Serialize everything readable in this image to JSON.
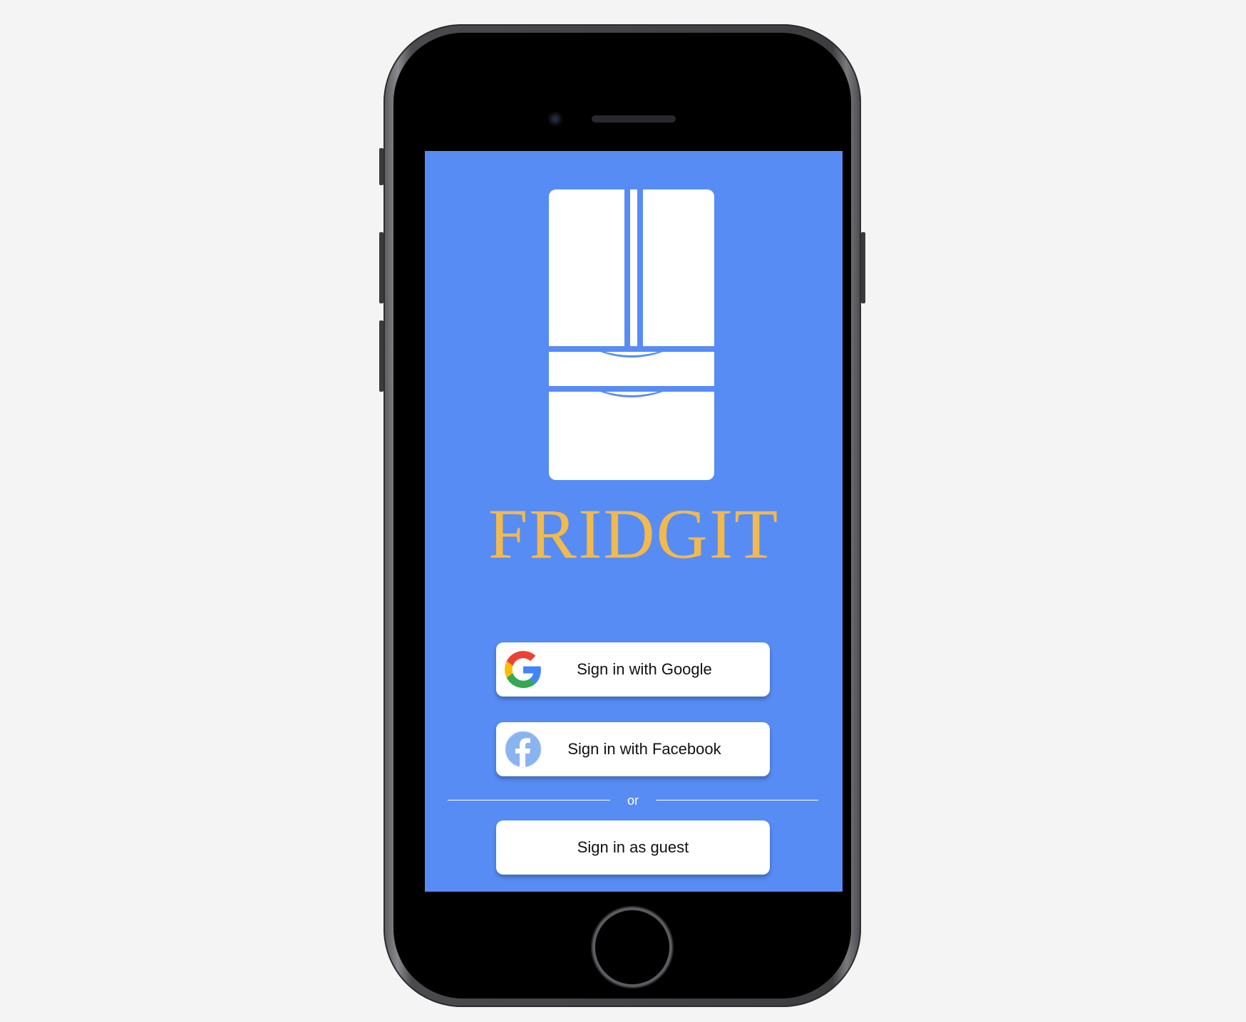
{
  "app": {
    "title": "FRIDGIT"
  },
  "buttons": {
    "google_label": "Sign in with Google",
    "facebook_label": "Sign in with Facebook",
    "guest_label": "Sign in as guest"
  },
  "divider": {
    "text": "or"
  },
  "icons": {
    "logo": "fridge-icon",
    "google": "google-icon",
    "facebook": "facebook-icon"
  },
  "colors": {
    "screen_background": "#578cf4",
    "title": "#f1b94e",
    "button_background": "#ffffff",
    "facebook_blue": "#1877f2"
  }
}
